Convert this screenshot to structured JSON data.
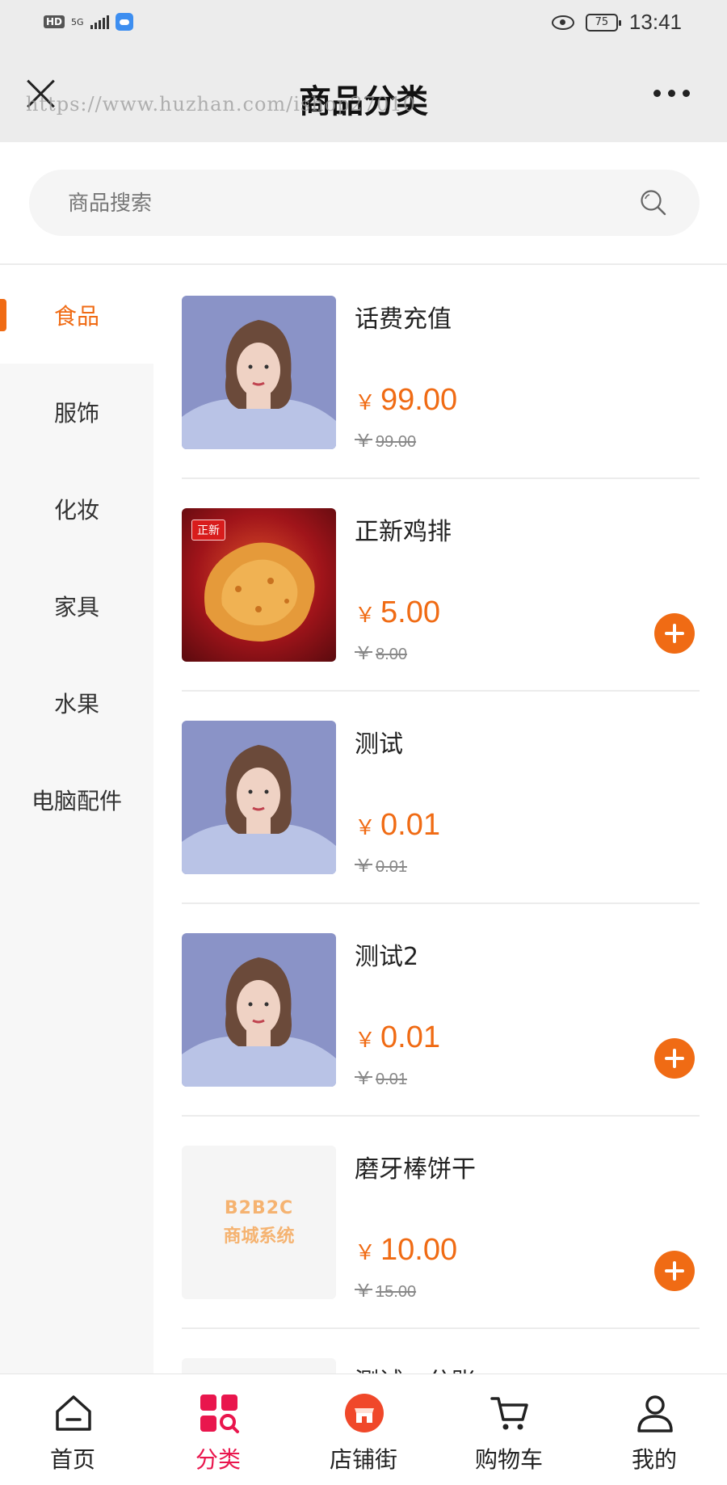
{
  "status_bar": {
    "hd": "HD",
    "network": "5G",
    "battery": "75",
    "time": "13:41"
  },
  "nav": {
    "title": "商品分类",
    "watermark": "https://www.huzhan.com/ishop27010"
  },
  "search": {
    "placeholder": "商品搜索"
  },
  "categories": [
    {
      "label": "食品",
      "active": true
    },
    {
      "label": "服饰"
    },
    {
      "label": "化妆"
    },
    {
      "label": "家具"
    },
    {
      "label": "水果"
    },
    {
      "label": "电脑配件"
    }
  ],
  "products": [
    {
      "name": "话费充值",
      "currency": "￥",
      "price": "99.00",
      "original": "99.00",
      "add": false,
      "image": "portrait-photo"
    },
    {
      "name": "正新鸡排",
      "currency": "￥",
      "price": "5.00",
      "original": "8.00",
      "add": true,
      "image": "fried-chicken-photo",
      "image_tag": "正新"
    },
    {
      "name": "测试",
      "currency": "￥",
      "price": "0.01",
      "original": "0.01",
      "add": false,
      "image": "portrait-photo"
    },
    {
      "name": "测试2",
      "currency": "￥",
      "price": "0.01",
      "original": "0.01",
      "add": true,
      "image": "portrait-photo"
    },
    {
      "name": "磨牙棒饼干",
      "currency": "￥",
      "price": "10.00",
      "original": "15.00",
      "add": true,
      "image": "placeholder",
      "placeholder_line1": "B2B2C",
      "placeholder_line2": "商城系统"
    },
    {
      "name": "测试一分账",
      "partial": true
    }
  ],
  "tabbar": [
    {
      "label": "首页",
      "icon": "home-icon"
    },
    {
      "label": "分类",
      "icon": "category-icon",
      "active": true
    },
    {
      "label": "店铺街",
      "icon": "shop-street-icon"
    },
    {
      "label": "购物车",
      "icon": "cart-icon"
    },
    {
      "label": "我的",
      "icon": "profile-icon"
    }
  ],
  "colors": {
    "accent": "#f06b14",
    "tab_active": "#e9164d",
    "background": "#ececec"
  }
}
